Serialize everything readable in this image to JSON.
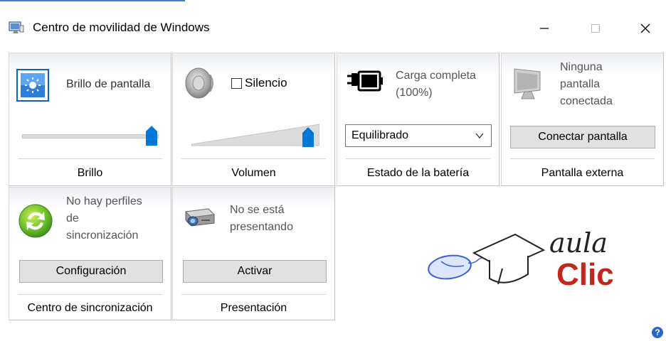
{
  "window": {
    "title": "Centro de movilidad de Windows",
    "icon": "mobility-center-icon",
    "controls": {
      "minimize": "minimize-icon",
      "maximize": "maximize-icon",
      "close": "close-icon"
    }
  },
  "tiles": {
    "brillo": {
      "status": "Brillo de pantalla",
      "caption": "Brillo",
      "icon": "brightness-icon",
      "slider_level": 0.97
    },
    "volumen": {
      "mute_label": "Silencio",
      "mute_checked": false,
      "caption": "Volumen",
      "icon": "speaker-icon",
      "slider_level": 0.92
    },
    "bateria": {
      "status_line1": "Carga completa",
      "status_line2": "(100%)",
      "plan_selected": "Equilibrado",
      "caption": "Estado de la batería",
      "icon": "battery-icon"
    },
    "pantalla_externa": {
      "status_line1": "Ninguna",
      "status_line2": "pantalla",
      "status_line3": "conectada",
      "button": "Conectar pantalla",
      "caption": "Pantalla externa",
      "icon": "monitor-icon"
    },
    "sincronizacion": {
      "status_line1": "No hay perfiles",
      "status_line2": "de",
      "status_line3": "sincronización",
      "button": "Configuración",
      "caption": "Centro de sincronización",
      "icon": "sync-icon"
    },
    "presentacion": {
      "status_line1": "No se está",
      "status_line2": "presentando",
      "button": "Activar",
      "caption": "Presentación",
      "icon": "projector-icon"
    }
  },
  "logo": {
    "word1": "aula",
    "word2": "Clic"
  },
  "colors": {
    "accent": "#0078d7",
    "logo_red": "#c0281c",
    "help_blue": "#2a68c8"
  }
}
